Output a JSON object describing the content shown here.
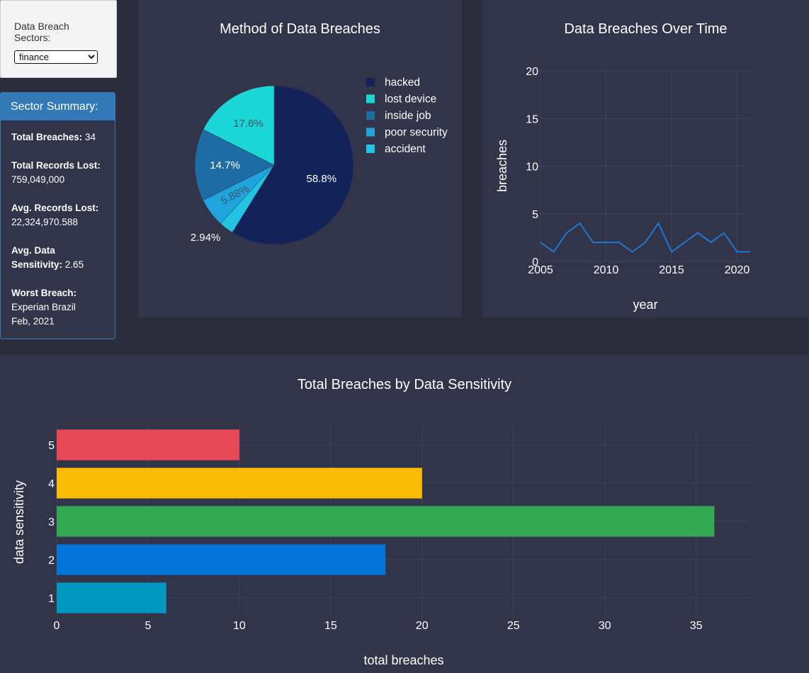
{
  "filter": {
    "label": "Data Breach Sectors:",
    "selected": "finance"
  },
  "summary": {
    "header": "Sector Summary:",
    "total_breaches_label": "Total Breaches:",
    "total_breaches": "34",
    "total_records_label": "Total Records Lost:",
    "total_records": "759,049,000",
    "avg_records_label": "Avg. Records Lost:",
    "avg_records": "22,324,970.588",
    "avg_sensitivity_label": "Avg. Data Sensitivity:",
    "avg_sensitivity": "2.65",
    "worst_label": "Worst Breach:",
    "worst_name": "Experian Brazil",
    "worst_date": "Feb, 2021"
  },
  "colors": {
    "panel": "#32354a",
    "grid": "#3f4257",
    "text": "#ffffff",
    "line": "#1f77d4"
  },
  "chart_data": [
    {
      "type": "pie",
      "title": "Method of Data Breaches",
      "labels": [
        "hacked",
        "lost device",
        "inside job",
        "poor security",
        "accident"
      ],
      "values": [
        58.8,
        17.6,
        14.7,
        5.88,
        2.94
      ],
      "value_labels": [
        "58.8%",
        "17.6%",
        "14.7%",
        "5.88%",
        "2.94%"
      ],
      "colors": [
        "#13235a",
        "#1ad6d6",
        "#1d6ca6",
        "#20a4dd",
        "#22c4e4"
      ],
      "legend": "right"
    },
    {
      "type": "line",
      "title": "Data Breaches Over Time",
      "xlabel": "year",
      "ylabel": "breaches",
      "x": [
        2005,
        2006,
        2007,
        2008,
        2009,
        2010,
        2011,
        2012,
        2013,
        2014,
        2015,
        2016,
        2017,
        2018,
        2019,
        2020,
        2021
      ],
      "y": [
        2,
        1,
        3,
        4,
        2,
        2,
        2,
        1,
        2,
        4,
        1,
        2,
        3,
        2,
        3,
        1,
        1
      ],
      "xlim": [
        2005,
        2021
      ],
      "ylim": [
        0,
        20
      ],
      "xticks": [
        2005,
        2010,
        2015,
        2020
      ],
      "yticks": [
        0,
        5,
        10,
        15,
        20
      ],
      "grid": true
    },
    {
      "type": "bar",
      "orientation": "horizontal",
      "title": "Total Breaches by Data Sensitivity",
      "xlabel": "total breaches",
      "ylabel": "data sensitivity",
      "categories": [
        "1",
        "2",
        "3",
        "4",
        "5"
      ],
      "values": [
        6,
        18,
        36,
        20,
        10
      ],
      "colors": [
        "#0097c1",
        "#0474d9",
        "#34a853",
        "#fbbc05",
        "#e84a57"
      ],
      "xlim": [
        0,
        38
      ],
      "xticks": [
        0,
        5,
        10,
        15,
        20,
        25,
        30,
        35
      ],
      "grid": true
    }
  ]
}
